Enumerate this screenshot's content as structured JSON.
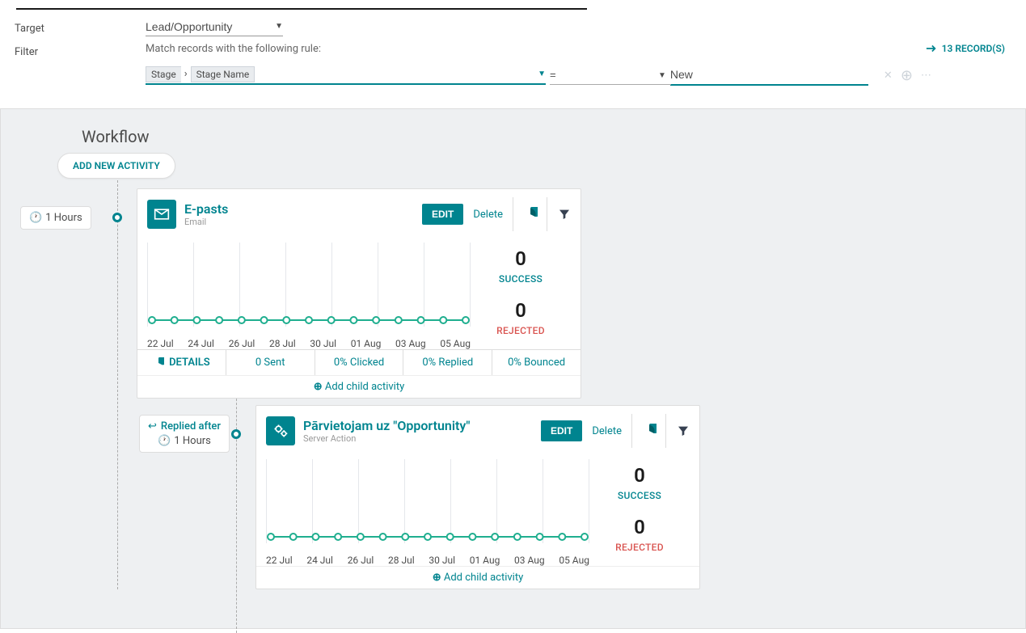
{
  "form": {
    "target_label": "Target",
    "target_value": "Lead/Opportunity",
    "filter_label": "Filter",
    "filter_text": "Match records with the following rule:",
    "records_link": "13 RECORD(S)",
    "rule": {
      "tag1": "Stage",
      "tag2": "Stage Name",
      "operator": "=",
      "value": "New"
    }
  },
  "workflow": {
    "title": "Workflow",
    "add_activity": "ADD NEW ACTIVITY",
    "nodes": [
      {
        "time_chip": "1 Hours",
        "title": "E-pasts",
        "subtitle": "Email",
        "edit": "EDIT",
        "delete": "Delete",
        "success_val": "0",
        "success_lbl": "SUCCESS",
        "rejected_val": "0",
        "rejected_lbl": "REJECTED",
        "details": "DETAILS",
        "sent": "0 Sent",
        "clicked": "0% Clicked",
        "replied": "0% Replied",
        "bounced": "0% Bounced",
        "add_child": "Add child activity"
      },
      {
        "condition": "Replied after",
        "time_chip": "1 Hours",
        "title": "Pārvietojam uz \"Opportunity\"",
        "subtitle": "Server Action",
        "edit": "EDIT",
        "delete": "Delete",
        "success_val": "0",
        "success_lbl": "SUCCESS",
        "rejected_val": "0",
        "rejected_lbl": "REJECTED",
        "add_child": "Add child activity"
      }
    ]
  },
  "chart_data": [
    {
      "type": "line",
      "title": "",
      "xlabel": "",
      "ylabel": "",
      "ylim": [
        0,
        1
      ],
      "categories": [
        "22 Jul",
        "23 Jul",
        "24 Jul",
        "25 Jul",
        "26 Jul",
        "27 Jul",
        "28 Jul",
        "29 Jul",
        "30 Jul",
        "31 Jul",
        "01 Aug",
        "02 Aug",
        "03 Aug",
        "04 Aug",
        "05 Aug"
      ],
      "values": [
        0,
        0,
        0,
        0,
        0,
        0,
        0,
        0,
        0,
        0,
        0,
        0,
        0,
        0,
        0
      ],
      "x_tick_labels": [
        "22 Jul",
        "24 Jul",
        "26 Jul",
        "28 Jul",
        "30 Jul",
        "01 Aug",
        "03 Aug",
        "05 Aug"
      ]
    },
    {
      "type": "line",
      "title": "",
      "xlabel": "",
      "ylabel": "",
      "ylim": [
        0,
        1
      ],
      "categories": [
        "22 Jul",
        "23 Jul",
        "24 Jul",
        "25 Jul",
        "26 Jul",
        "27 Jul",
        "28 Jul",
        "29 Jul",
        "30 Jul",
        "31 Jul",
        "01 Aug",
        "02 Aug",
        "03 Aug",
        "04 Aug",
        "05 Aug"
      ],
      "values": [
        0,
        0,
        0,
        0,
        0,
        0,
        0,
        0,
        0,
        0,
        0,
        0,
        0,
        0,
        0
      ],
      "x_tick_labels": [
        "22 Jul",
        "24 Jul",
        "26 Jul",
        "28 Jul",
        "30 Jul",
        "01 Aug",
        "03 Aug",
        "05 Aug"
      ]
    }
  ]
}
